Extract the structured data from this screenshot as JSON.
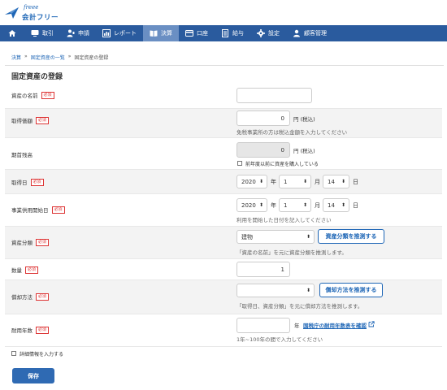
{
  "header": {
    "logo_script": "freee",
    "logo_text": "会計フリー"
  },
  "nav": {
    "items": [
      {
        "label": "取引"
      },
      {
        "label": "申請"
      },
      {
        "label": "レポート"
      },
      {
        "label": "決算"
      },
      {
        "label": "口座"
      },
      {
        "label": "給与"
      },
      {
        "label": "設定"
      },
      {
        "label": "顧客管理"
      }
    ]
  },
  "breadcrumb": {
    "items": [
      "決算",
      "固定資産の一覧",
      "固定資産の登録"
    ],
    "separator": "»"
  },
  "page": {
    "title": "固定資産の登録"
  },
  "required_badge": "必須",
  "form": {
    "asset_name": {
      "label": "資産の名前",
      "value": ""
    },
    "acquisition_price": {
      "label": "取得価額",
      "value": "0",
      "unit": "円 (税込)",
      "hint": "免税事業所の方は税込金額を入力してください"
    },
    "opening_balance": {
      "label": "期首残高",
      "value": "0",
      "unit": "円 (税込)",
      "checkbox_label": "前年度以前に資産を購入している"
    },
    "acquisition_date": {
      "label": "取得日",
      "year": "2020",
      "month": "1",
      "day": "14",
      "year_unit": "年",
      "month_unit": "月",
      "day_unit": "日"
    },
    "business_start_date": {
      "label": "事業供用開始日",
      "year": "2020",
      "month": "1",
      "day": "14",
      "year_unit": "年",
      "month_unit": "月",
      "day_unit": "日",
      "hint": "利用を開始した日付を記入してください"
    },
    "asset_category": {
      "label": "資産分類",
      "value": "建物",
      "button": "資産分類を推測する",
      "hint": "「資産の名前」を元に資産分類を推測します。"
    },
    "quantity": {
      "label": "数量",
      "value": "1"
    },
    "depreciation_method": {
      "label": "償却方法",
      "value": "",
      "button": "償却方法を推測する",
      "hint": "「取得日、資産分類」を元に償却方法を推測します。"
    },
    "useful_life": {
      "label": "耐用年数",
      "value": "",
      "unit": "年",
      "link": "国税庁の耐用年数表を確認",
      "hint": "1年~100年の間で入力してください"
    }
  },
  "detail_checkbox_label": "詳細情報を入力する",
  "save_label": "保存",
  "colors": {
    "nav": "#2a5b9e",
    "nav_active": "#6a8fc3",
    "accent": "#1e66b6",
    "required": "#dd3333",
    "save": "#2f6ab3"
  }
}
